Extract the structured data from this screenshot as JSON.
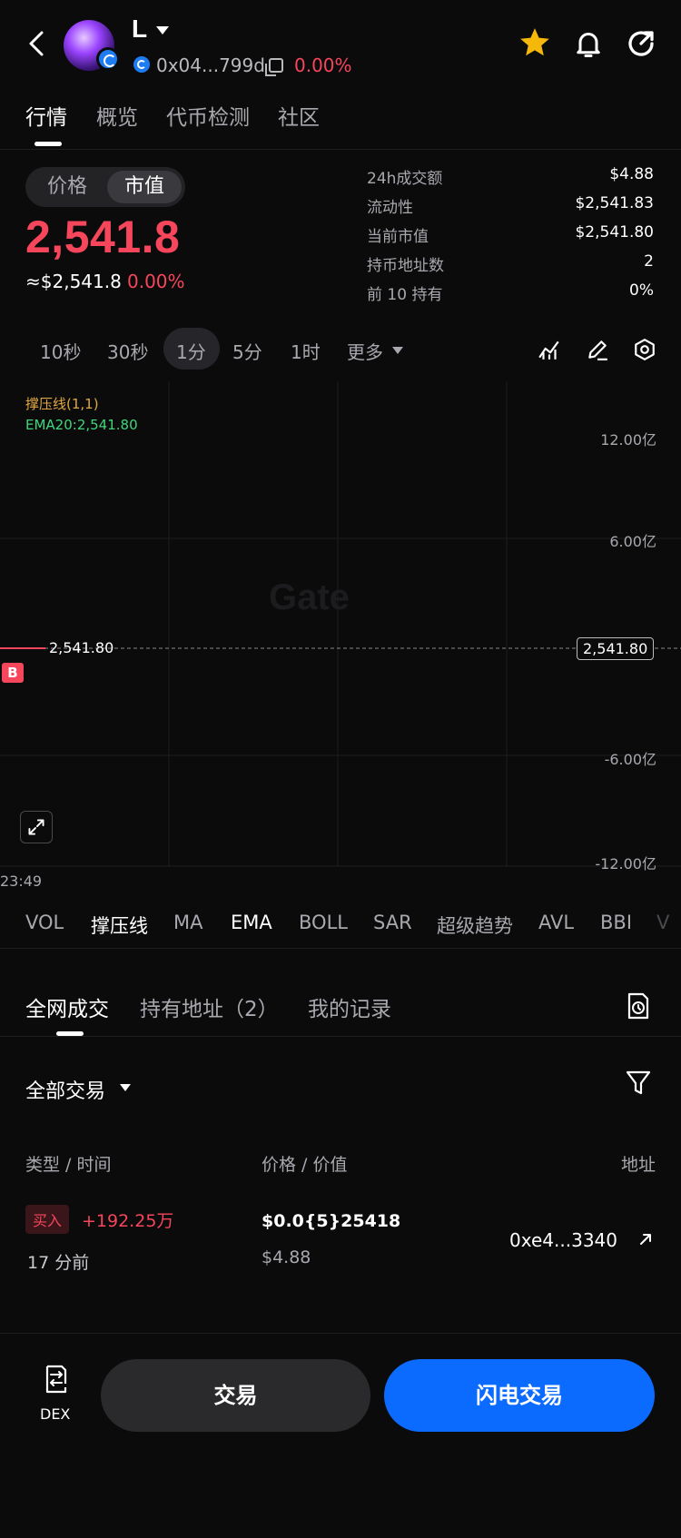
{
  "header": {
    "token_name": "L",
    "address": "0x04...799d",
    "change": "0.00%"
  },
  "main_tabs": [
    "行情",
    "概览",
    "代币检测",
    "社区"
  ],
  "price_toggle": {
    "price": "价格",
    "market_cap": "市值"
  },
  "price": {
    "value": "2,541.8",
    "usd": "≈$2,541.8",
    "change": "0.00%"
  },
  "stats": [
    {
      "label": "24h成交额",
      "value": "$4.88"
    },
    {
      "label": "流动性",
      "value": "$2,541.83"
    },
    {
      "label": "当前市值",
      "value": "$2,541.80"
    },
    {
      "label": "持币地址数",
      "value": "2"
    },
    {
      "label": "前 10 持有",
      "value": "0%"
    }
  ],
  "timeframes": [
    "10秒",
    "30秒",
    "1分",
    "5分",
    "1时",
    "更多"
  ],
  "timeframe_selected": "1分",
  "chart": {
    "overlay_1": "撑压线(1,1)",
    "overlay_2": "EMA20:2,541.80",
    "y_labels": [
      "12.00亿",
      "6.00亿",
      "-6.00亿",
      "-12.00亿"
    ],
    "current_value": "2,541.80",
    "marker": "B",
    "watermark": "Gate",
    "x_label": "23:49"
  },
  "indicators": [
    "VOL",
    "撑压线",
    "MA",
    "EMA",
    "BOLL",
    "SAR",
    "超级趋势",
    "AVL",
    "BBI",
    "V"
  ],
  "trade_tabs": [
    "全网成交",
    "持有地址（2）",
    "我的记录"
  ],
  "filter_label": "全部交易",
  "columns": {
    "type_time": "类型 / 时间",
    "price_value": "价格 / 价值",
    "address": "地址"
  },
  "trades": [
    {
      "type": "买入",
      "amount": "+192.25万",
      "time": "17 分前",
      "price": "$0.0{5}25418",
      "value": "$4.88",
      "address": "0xe4...3340"
    }
  ],
  "bottom": {
    "dex_label": "DEX",
    "trade_label": "交易",
    "flash_label": "闪电交易"
  },
  "colors": {
    "accent_red": "#f5465b",
    "accent_blue": "#0b6bff",
    "ema_green": "#3fd67b",
    "overlay_orange": "#e0a742",
    "star": "#f5b80a"
  }
}
